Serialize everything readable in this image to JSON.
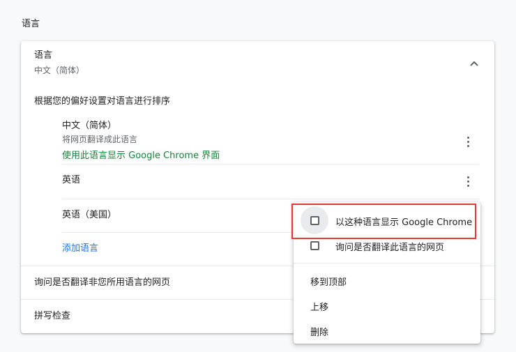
{
  "section": {
    "title": "语言"
  },
  "language_panel": {
    "title": "语言",
    "current_value": "中文（简体）",
    "order_heading": "根据您的偏好设置对语言进行排序",
    "languages": [
      {
        "name": "中文（简体）",
        "note": "将网页翻译成此语言",
        "ui_note": "使用此语言显示 Google Chrome 界面"
      },
      {
        "name": "英语"
      },
      {
        "name": "英语（美国）"
      }
    ],
    "add_language": "添加语言",
    "offer_translate": "询问是否翻译非您所用语言的网页",
    "spellcheck": "拼写检查"
  },
  "context_menu": {
    "display_in_language": "以这种语言显示 Google Chrome",
    "offer_translate_language": "询问是否翻译此语言的网页",
    "move_to_top": "移到顶部",
    "move_up": "上移",
    "remove": "删除"
  },
  "colors": {
    "accent_blue": "#1a73e8",
    "green": "#188038",
    "highlight_red": "#e53935"
  },
  "icons": [
    "chevron-up-icon",
    "more-vert-icon",
    "checkbox-unchecked-icon"
  ]
}
